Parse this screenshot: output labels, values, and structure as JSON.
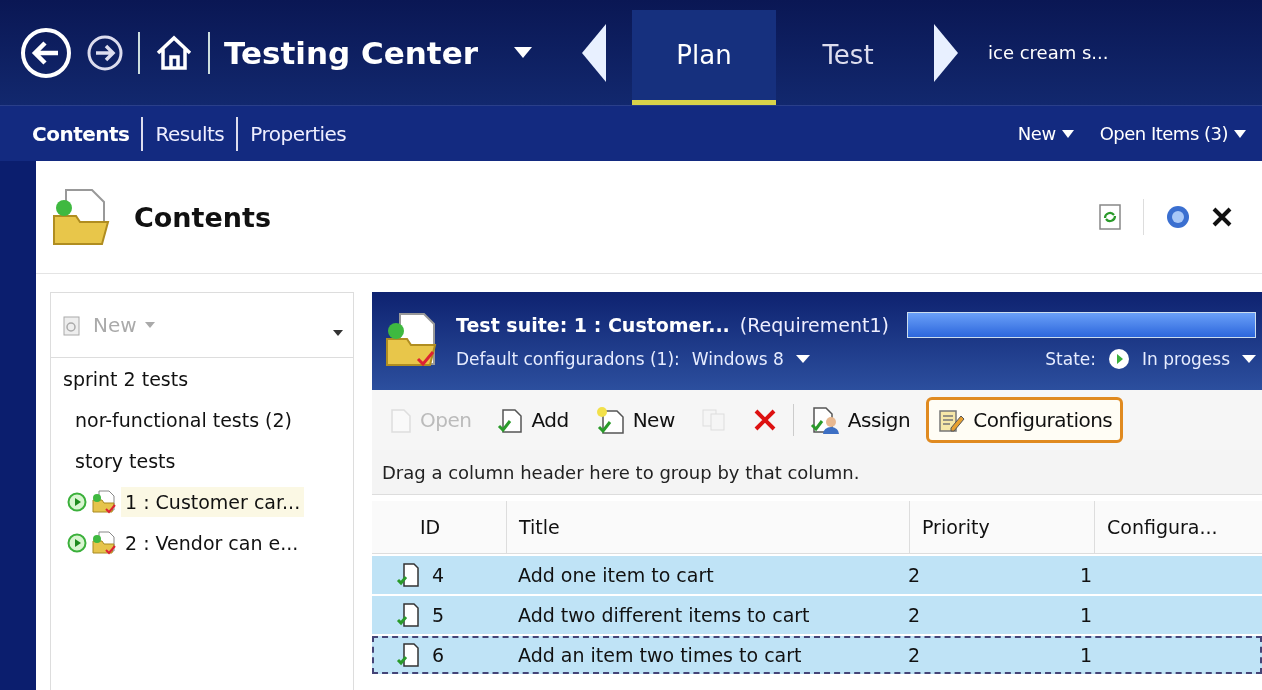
{
  "nav": {
    "title": "Testing Center",
    "tabs": [
      {
        "label": "Plan",
        "selected": true
      },
      {
        "label": "Test",
        "selected": false
      }
    ],
    "breadcrumb": "ice cream s..."
  },
  "subnav": {
    "tabs": [
      {
        "label": "Contents",
        "selected": true
      },
      {
        "label": "Results",
        "selected": false
      },
      {
        "label": "Properties",
        "selected": false
      }
    ],
    "actions": [
      "New",
      "Open Items (3)"
    ]
  },
  "panel": {
    "title": "Contents"
  },
  "tree": {
    "new_button": {
      "label": "New",
      "disabled": true
    },
    "items": [
      {
        "label": "sprint 2 tests",
        "selected": false,
        "children": [
          {
            "label": "nor-functional tests (2)",
            "selected": false
          },
          {
            "label": "story tests",
            "selected": false,
            "children": [
              {
                "label": "1 : Customer car...",
                "selected": true,
                "kind": "suite"
              },
              {
                "label": "2 : Vendor can e...",
                "selected": false,
                "kind": "suite"
              }
            ]
          }
        ]
      }
    ]
  },
  "suite": {
    "title": "Test suite:  1 : Customer...",
    "requirement": "(Requirement1)",
    "level": 1,
    "config_label": "Default configuradons (1):",
    "config_value": "Windows 8",
    "state_label": "State:",
    "state_value": "In progess"
  },
  "toolbar": [
    {
      "label": "Open",
      "kind": "open",
      "disabled": true,
      "highlighted": false
    },
    {
      "label": "Add",
      "kind": "add",
      "disabled": false,
      "highlighted": false
    },
    {
      "label": "New",
      "kind": "new",
      "disabled": false,
      "highlighted": false
    },
    {
      "kind": "copy",
      "disabled": true,
      "highlighted": false
    },
    {
      "kind": "delete",
      "disabled": false,
      "highlighted": false
    },
    {
      "label": "Assign",
      "kind": "assign",
      "disabled": false,
      "highlighted": false
    },
    {
      "label": "Configurations",
      "kind": "config",
      "disabled": false,
      "highlighted": true
    }
  ],
  "group_hint": "Drag a column header here to group by that column.",
  "table": {
    "columns": [
      "ID",
      "Title",
      "Priority",
      "Configura..."
    ],
    "rows": [
      {
        "cells": [
          "4",
          "Add one item to cart",
          "2",
          "1"
        ],
        "selected": true,
        "focused": false
      },
      {
        "cells": [
          "5",
          "Add two different items to cart",
          "2",
          "1"
        ],
        "selected": true,
        "focused": false
      },
      {
        "cells": [
          "6",
          "Add an item two times to cart",
          "2",
          "1"
        ],
        "selected": true,
        "focused": true
      }
    ]
  }
}
